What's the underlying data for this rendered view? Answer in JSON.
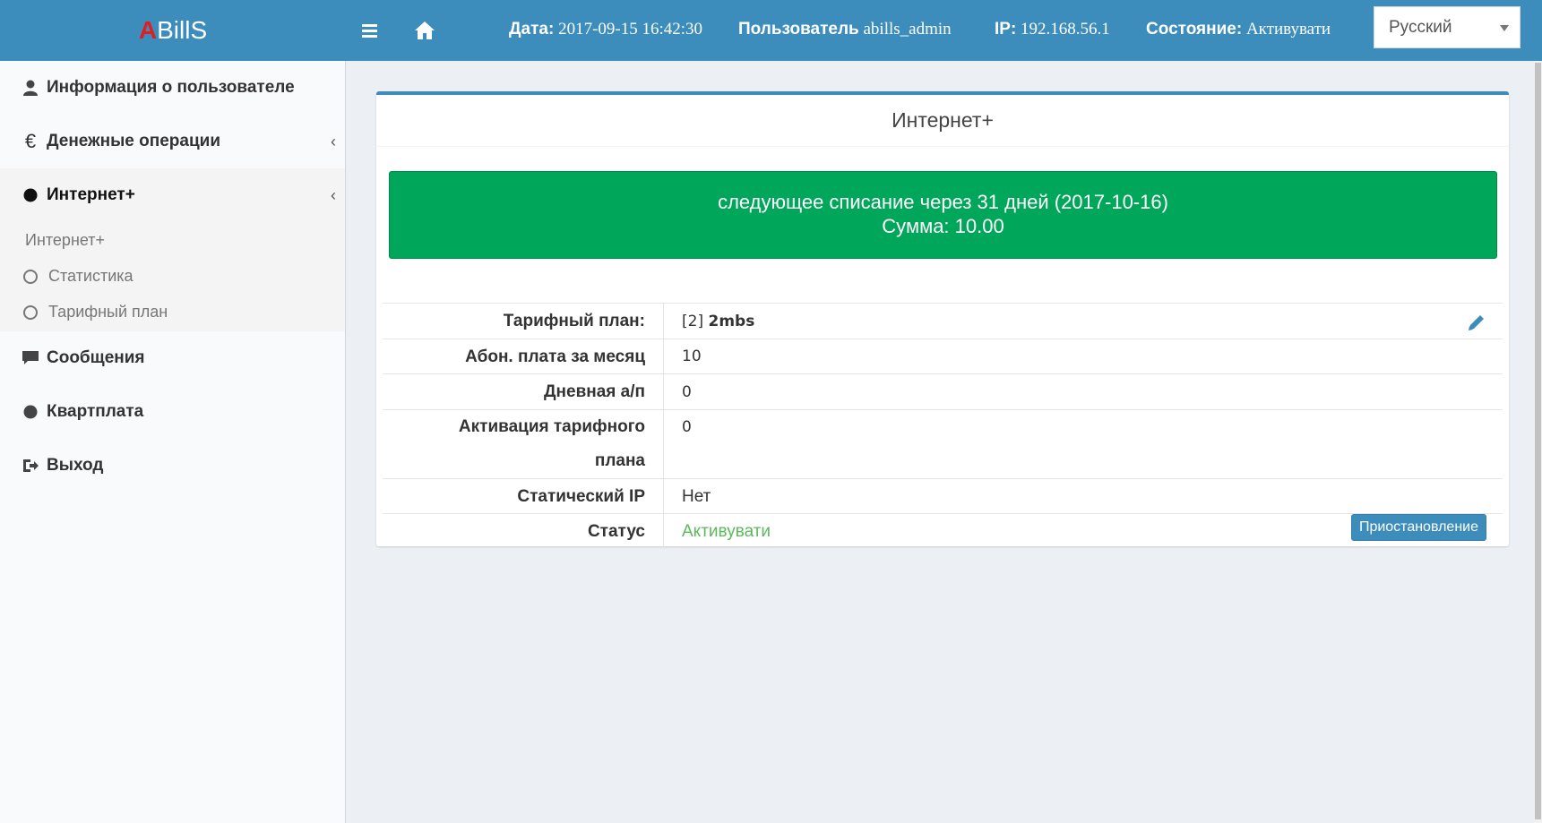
{
  "header": {
    "logo_a": "A",
    "logo_rest": "BillS",
    "date_label": "Дата:",
    "date_value": "2017-09-15 16:42:30",
    "user_label": "Пользователь",
    "user_value": "abills_admin",
    "ip_label": "IP:",
    "ip_value": "192.168.56.1",
    "state_label": "Состояние:",
    "state_value": "Активувати",
    "language": "Русский"
  },
  "sidebar": {
    "items": [
      {
        "label": "Информация о пользователе",
        "icon": "user-icon"
      },
      {
        "label": "Денежные операции",
        "icon": "euro-icon"
      },
      {
        "label": "Интернет+",
        "icon": "dot-icon"
      },
      {
        "label": "Сообщения",
        "icon": "message-icon"
      },
      {
        "label": "Квартплата",
        "icon": "dot-icon"
      },
      {
        "label": "Выход",
        "icon": "logout-icon"
      }
    ],
    "submenu_header": "Интернет+",
    "submenu": [
      "Статистика",
      "Тарифный план"
    ]
  },
  "box": {
    "title": "Интернет+",
    "alert_line1": "следующее списание через 31 дней (2017-10-16)",
    "alert_line2": "Сумма: 10.00",
    "rows": [
      {
        "label": "Тарифный план:",
        "value_prefix": "[2]",
        "value": "2mbs"
      },
      {
        "label": "Абон. плата за месяц",
        "value": "10"
      },
      {
        "label": "Дневная а/п",
        "value": "0"
      },
      {
        "label_line1": "Активация тарифного",
        "label_line2": "плана",
        "value": "0"
      },
      {
        "label": "Статический IP",
        "value": "Нет"
      },
      {
        "label": "Статус",
        "value": "Активувати"
      }
    ],
    "suspend_button": "Приостановление"
  },
  "colors": {
    "header": "#3c8dbc",
    "alert_success": "#00a65a",
    "status_active": "#5cb85c"
  }
}
